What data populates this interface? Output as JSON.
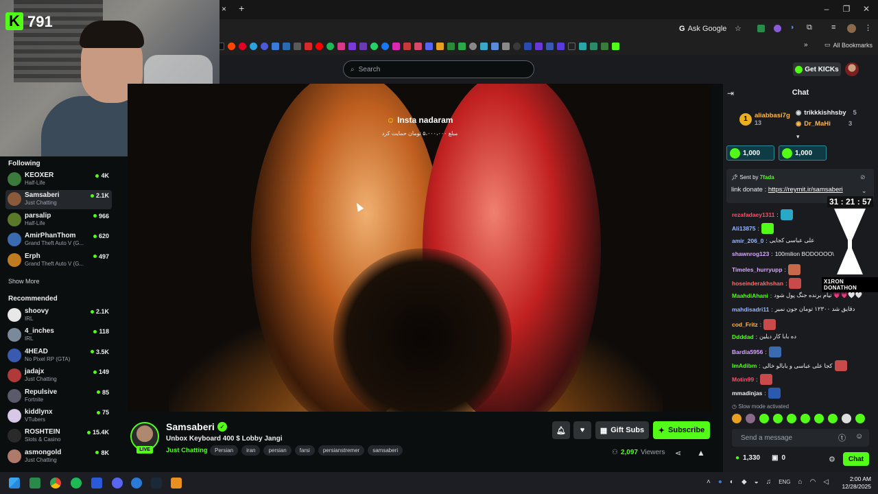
{
  "overlay": {
    "kicks_count": "791",
    "timer": "31 : 21 : 57",
    "donathon_label": "X1RON DONATHON"
  },
  "browser": {
    "ask_google": "Ask Google",
    "all_bookmarks": "All Bookmarks",
    "new_tab": "+",
    "close_tab": "×"
  },
  "header": {
    "search_placeholder": "Search",
    "get_kicks": "Get KICKs"
  },
  "sidebar": {
    "following_label": "Following",
    "following": [
      {
        "name": "KEOXER",
        "category": "Half-Life",
        "viewers": "4K",
        "color": "#3b7a3b"
      },
      {
        "name": "Samsaberi",
        "category": "Just Chatting",
        "viewers": "2.1K",
        "color": "#8a5a3a",
        "active": true
      },
      {
        "name": "parsalip",
        "category": "Half-Life",
        "viewers": "966",
        "color": "#5a7a2a"
      },
      {
        "name": "AmirPhanThom",
        "category": "Grand Theft Auto V (G...",
        "viewers": "620",
        "color": "#3a6ab0"
      },
      {
        "name": "Erph",
        "category": "Grand Theft Auto V (G...",
        "viewers": "497",
        "color": "#c07a20"
      }
    ],
    "show_more": "Show More",
    "recommended_label": "Recommended",
    "recommended": [
      {
        "name": "shoovy",
        "category": "IRL",
        "viewers": "2.1K",
        "color": "#e8e8e8"
      },
      {
        "name": "4_inches",
        "category": "IRL",
        "viewers": "118",
        "color": "#7a8a9a"
      },
      {
        "name": "4HEAD",
        "category": "No Pixel RP (GTA)",
        "viewers": "3.5K",
        "color": "#3a5ab0"
      },
      {
        "name": "jadajx",
        "category": "Just Chatting",
        "viewers": "149",
        "color": "#b03a3a"
      },
      {
        "name": "Repulsive",
        "category": "Fortnite",
        "viewers": "85",
        "color": "#5a5a6a"
      },
      {
        "name": "kiddlynx",
        "category": "VTubers",
        "viewers": "75",
        "color": "#d8c8e8"
      },
      {
        "name": "ROSHTEIN",
        "category": "Slots & Casino",
        "viewers": "15.4K",
        "color": "#2a2a2a"
      },
      {
        "name": "asmongold",
        "category": "Just Chatting",
        "viewers": "8K",
        "color": "#b07a6a"
      }
    ]
  },
  "video": {
    "alert_title": "Insta nadaram",
    "alert_sub": "مبلغ ۵،۰۰۰،۰۰۰ تومان حمایت کرد"
  },
  "stream": {
    "streamer": "Samsaberi",
    "live": "LIVE",
    "title": "Unbox Keyboard 400 $ Lobby Jangi",
    "category": "Just Chatting",
    "tags": [
      "Persian",
      "iran",
      "persian",
      "farsi",
      "persianstremer",
      "samsaberi"
    ],
    "gift_subs": "Gift Subs",
    "subscribe": "Subscribe",
    "viewers_count": "2,097",
    "viewers_label": "Viewers"
  },
  "chat": {
    "title": "Chat",
    "leaderboard": [
      {
        "name": "aliabbasi7g",
        "count": "13"
      },
      {
        "name": "trikkkishhsby",
        "count": "5"
      },
      {
        "name": "Dr_MaHi",
        "count": "3"
      }
    ],
    "gifts": [
      "1,000",
      "1,000"
    ],
    "pinned_sent_by": "Sent by",
    "pinned_user": "7fada",
    "pinned_text": "link donate : ",
    "pinned_link": "https://reymit.ir/samsaberi",
    "messages": [
      {
        "user": "rezafadaey1311",
        "text": "",
        "color": "#ff4d6a",
        "emote": "#2aa8c8"
      },
      {
        "user": "Ali13875",
        "text": "",
        "color": "#9ab8ff",
        "emote": "#53fc18"
      },
      {
        "user": "amir_206_0",
        "text": "علی عباسی کجایی",
        "color": "#9ab8ff"
      },
      {
        "user": "shawnrog123",
        "text": "100milion BODOOOO\\",
        "color": "#d8a8ff"
      },
      {
        "user": "Timeles_hurryupp",
        "text": "",
        "color": "#d8a8ff",
        "emote": "#c86a4a"
      },
      {
        "user": "hoseinderakhshan",
        "text": "",
        "color": "#ff6a6a",
        "emote": "#c84a4a"
      },
      {
        "user": "MaahdiAhani",
        "text": "تیام برنده جنگ پول شود 💗💗🤍🤍",
        "color": "#53fc18"
      },
      {
        "user": "mahdisadri11",
        "text": "دقایق شد ۱۲۳۰۰ تومان جون نمیر",
        "color": "#9ab8ff"
      },
      {
        "user": "cod_Fritz",
        "text": "",
        "color": "#ffb84a",
        "emote": "#c84a4a"
      },
      {
        "user": "Ddddad",
        "text": "ده بابا کار دیلین",
        "color": "#53fc18"
      },
      {
        "user": "Bardia5956",
        "text": "",
        "color": "#d8a8ff",
        "emote": "#3a6ab0"
      },
      {
        "user": "ImAdibm",
        "text": "کجا علی عباسی و بابالو خالی",
        "color": "#53fc18",
        "emote": "#c84a4a"
      },
      {
        "user": "Motin99",
        "text": "",
        "color": "#ff4d6a",
        "emote": "#c84a4a"
      },
      {
        "user": "mmadinjas",
        "text": "",
        "color": "#efeff1",
        "emote": "#2a5ab0"
      }
    ],
    "slow_mode": "Slow mode activated",
    "input_placeholder": "Send a message",
    "points": "1,330",
    "gifts_count": "0",
    "send_button": "Chat"
  },
  "taskbar": {
    "lang": "ENG",
    "time": "2:00 AM",
    "date": "12/28/2025"
  }
}
